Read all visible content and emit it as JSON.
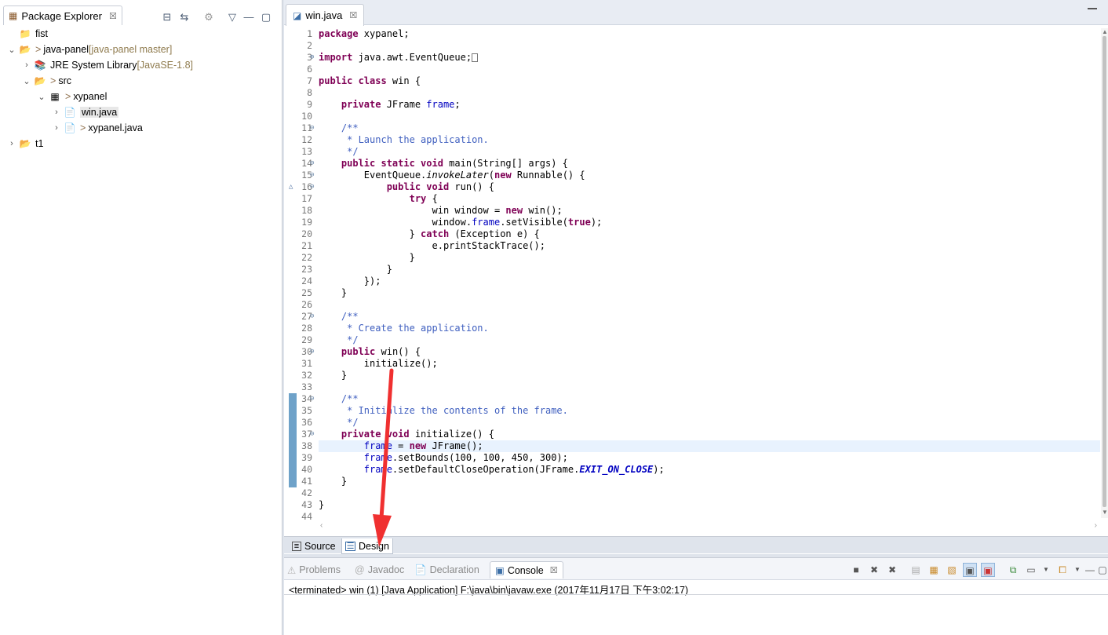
{
  "package_explorer": {
    "title": "Package Explorer",
    "close": "☒",
    "tree": [
      {
        "indent": 0,
        "twisty": "",
        "icon": "📁",
        "icon_name": "folder-icon",
        "label": "fist",
        "decor": "",
        "extra": "",
        "selected": false
      },
      {
        "indent": 0,
        "twisty": "⌄",
        "icon": "📂",
        "icon_name": "git-project-icon",
        "label": "java-panel",
        "decor": "> ",
        "extra": " [java-panel master]",
        "selected": false
      },
      {
        "indent": 1,
        "twisty": "›",
        "icon": "📚",
        "icon_name": "library-icon",
        "label": "JRE System Library",
        "decor": "",
        "extra": " [JavaSE-1.8]",
        "selected": false
      },
      {
        "indent": 1,
        "twisty": "⌄",
        "icon": "📂",
        "icon_name": "source-folder-icon",
        "label": "src",
        "decor": "> ",
        "extra": "",
        "selected": false
      },
      {
        "indent": 2,
        "twisty": "⌄",
        "icon": "▦",
        "icon_name": "package-icon",
        "label": "xypanel",
        "decor": "> ",
        "extra": "",
        "selected": false
      },
      {
        "indent": 3,
        "twisty": "›",
        "icon": "📄",
        "icon_name": "java-file-icon",
        "label": "win.java",
        "decor": "",
        "extra": "",
        "selected": true
      },
      {
        "indent": 3,
        "twisty": "›",
        "icon": "📄",
        "icon_name": "java-file-icon",
        "label": "xypanel.java",
        "decor": "> ",
        "extra": "",
        "selected": false
      },
      {
        "indent": 0,
        "twisty": "›",
        "icon": "📂",
        "icon_name": "project-icon",
        "label": "t1",
        "decor": "",
        "extra": "",
        "selected": false
      }
    ]
  },
  "editor": {
    "tab_label": "win.java",
    "tab_close": "☒",
    "bottom_tabs": {
      "source": "Source",
      "design": "Design"
    },
    "lines": [
      {
        "n": "1",
        "fold": "",
        "html": "<span class=\"kw\">package</span> xypanel;"
      },
      {
        "n": "2",
        "fold": "",
        "html": ""
      },
      {
        "n": "3",
        "fold": "⊕",
        "html": "<span class=\"kw\">import</span> java.awt.EventQueue;<span class=\"boxed\"></span>"
      },
      {
        "n": "6",
        "fold": "",
        "html": ""
      },
      {
        "n": "7",
        "fold": "",
        "html": "<span class=\"kw\">public class</span> win {"
      },
      {
        "n": "8",
        "fold": "",
        "html": ""
      },
      {
        "n": "9",
        "fold": "",
        "html": "    <span class=\"kw\">private</span> JFrame <span class=\"fld\">frame</span>;"
      },
      {
        "n": "10",
        "fold": "",
        "html": ""
      },
      {
        "n": "11",
        "fold": "⊖",
        "html": "    <span class=\"cm\">/**</span>"
      },
      {
        "n": "12",
        "fold": "",
        "html": "<span class=\"cm\">     * Launch the application.</span>"
      },
      {
        "n": "13",
        "fold": "",
        "html": "<span class=\"cm\">     */</span>"
      },
      {
        "n": "14",
        "fold": "⊖",
        "html": "    <span class=\"kw\">public static void</span> main(String[] args) {"
      },
      {
        "n": "15",
        "fold": "⊖",
        "html": "        EventQueue.<span class=\"it\">invokeLater</span>(<span class=\"kw\">new</span> Runnable() {"
      },
      {
        "n": "16",
        "fold": "⊖",
        "html": "            <span class=\"kw\">public void</span> run() {"
      },
      {
        "n": "17",
        "fold": "",
        "html": "                <span class=\"kw\">try</span> {"
      },
      {
        "n": "18",
        "fold": "",
        "html": "                    win window = <span class=\"kw\">new</span> win();"
      },
      {
        "n": "19",
        "fold": "",
        "html": "                    window.<span class=\"fld\">frame</span>.setVisible(<span class=\"kw\">true</span>);"
      },
      {
        "n": "20",
        "fold": "",
        "html": "                } <span class=\"kw\">catch</span> (Exception e) {"
      },
      {
        "n": "21",
        "fold": "",
        "html": "                    e.printStackTrace();"
      },
      {
        "n": "22",
        "fold": "",
        "html": "                }"
      },
      {
        "n": "23",
        "fold": "",
        "html": "            }"
      },
      {
        "n": "24",
        "fold": "",
        "html": "        });"
      },
      {
        "n": "25",
        "fold": "",
        "html": "    }"
      },
      {
        "n": "26",
        "fold": "",
        "html": ""
      },
      {
        "n": "27",
        "fold": "⊖",
        "html": "    <span class=\"cm\">/**</span>"
      },
      {
        "n": "28",
        "fold": "",
        "html": "<span class=\"cm\">     * Create the application.</span>"
      },
      {
        "n": "29",
        "fold": "",
        "html": "<span class=\"cm\">     */</span>"
      },
      {
        "n": "30",
        "fold": "⊖",
        "html": "    <span class=\"kw\">public</span> win() {"
      },
      {
        "n": "31",
        "fold": "",
        "html": "        initialize();"
      },
      {
        "n": "32",
        "fold": "",
        "html": "    }"
      },
      {
        "n": "33",
        "fold": "",
        "html": ""
      },
      {
        "n": "34",
        "fold": "⊖",
        "html": "    <span class=\"cm\">/**</span>"
      },
      {
        "n": "35",
        "fold": "",
        "html": "<span class=\"cm\">     * Initialize the contents of the frame.</span>"
      },
      {
        "n": "36",
        "fold": "",
        "html": "<span class=\"cm\">     */</span>"
      },
      {
        "n": "37",
        "fold": "⊖",
        "html": "    <span class=\"kw\">private void</span> initialize() {"
      },
      {
        "n": "38",
        "fold": "",
        "html": "        <span class=\"fld\">frame</span> = <span class=\"kw\">new</span> JFrame();"
      },
      {
        "n": "39",
        "fold": "",
        "html": "        <span class=\"fld\">frame</span>.setBounds(100, 100, 450, 300);"
      },
      {
        "n": "40",
        "fold": "",
        "html": "        <span class=\"fld\">frame</span>.setDefaultCloseOperation(JFrame.<span class=\"cst\">EXIT_ON_CLOSE</span>);"
      },
      {
        "n": "41",
        "fold": "",
        "html": "    }"
      },
      {
        "n": "42",
        "fold": "",
        "html": ""
      },
      {
        "n": "43",
        "fold": "",
        "html": "}"
      },
      {
        "n": "44",
        "fold": "",
        "html": ""
      }
    ],
    "highlighted_line": "38",
    "quick_access_lines": [
      "34",
      "35",
      "36",
      "37",
      "38",
      "39",
      "40",
      "41"
    ],
    "override_marker_line": "16"
  },
  "console": {
    "tabs": [
      {
        "label": "Problems",
        "icon": "⚠",
        "icon_name": "problems-icon",
        "active": false
      },
      {
        "label": "Javadoc",
        "icon": "@",
        "icon_name": "javadoc-icon",
        "active": false
      },
      {
        "label": "Declaration",
        "icon": "📄",
        "icon_name": "declaration-icon",
        "active": false
      },
      {
        "label": "Console",
        "icon": "▣",
        "icon_name": "console-icon",
        "active": true
      }
    ],
    "close": "☒",
    "output": "<terminated> win (1) [Java Application] F:\\java\\bin\\javaw.exe (2017年11月17日 下午3:02:17)"
  },
  "colors": {
    "keyword": "#7f0055",
    "field": "#0000c0",
    "comment": "#3f5fbf",
    "annotation_arrow": "#f03030"
  }
}
